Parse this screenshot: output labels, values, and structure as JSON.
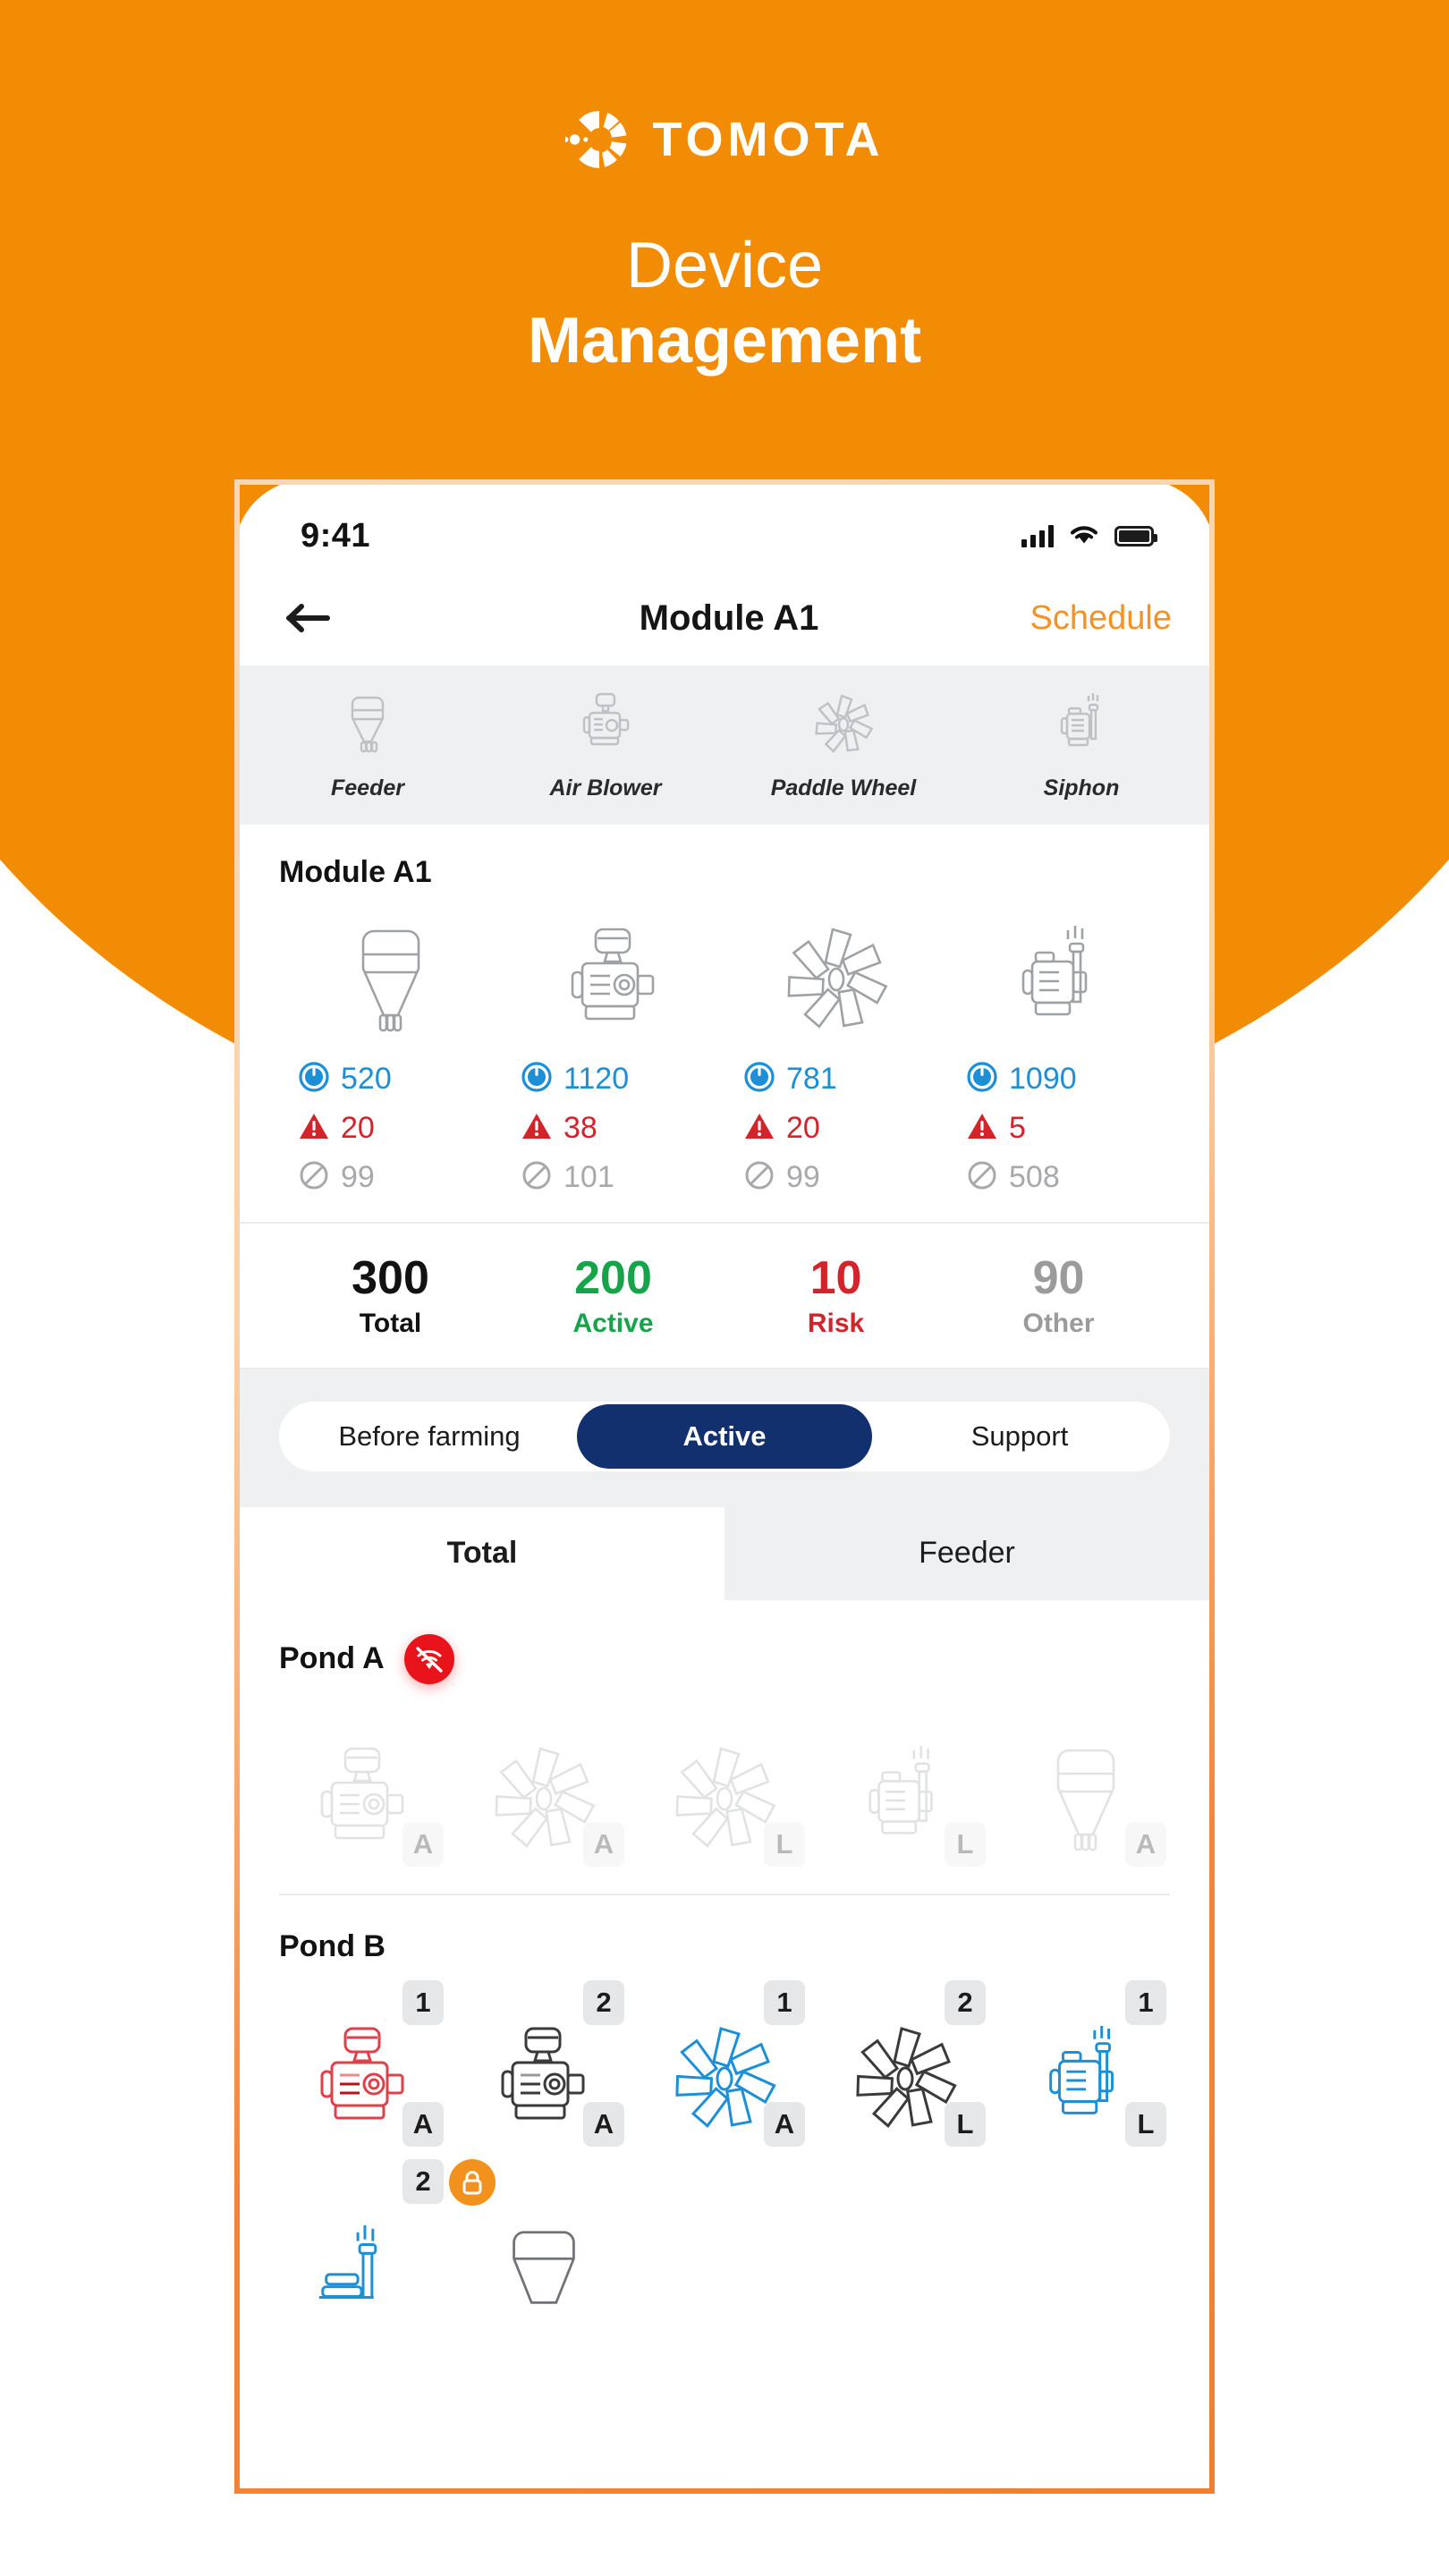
{
  "brand": {
    "name": "TOMOTA",
    "logo_icon": "tomota-circle-logo"
  },
  "hero": {
    "line1": "Device",
    "line2": "Management"
  },
  "statusbar": {
    "time": "9:41",
    "signal_icon": "cellular-signal-icon",
    "wifi_icon": "wifi-icon",
    "battery_icon": "battery-full-icon"
  },
  "navbar": {
    "back_icon": "back-arrow-icon",
    "title": "Module A1",
    "action": "Schedule",
    "action_color": "#F59226"
  },
  "categories": [
    {
      "label": "Feeder",
      "icon": "feeder-icon"
    },
    {
      "label": "Air Blower",
      "icon": "air-blower-icon"
    },
    {
      "label": "Paddle Wheel",
      "icon": "paddle-wheel-icon"
    },
    {
      "label": "Siphon",
      "icon": "siphon-icon"
    }
  ],
  "module": {
    "name": "Module A1",
    "devices": [
      {
        "icon": "feeder-icon",
        "power": "520",
        "risk": "20",
        "off": "99"
      },
      {
        "icon": "air-blower-icon",
        "power": "1120",
        "risk": "38",
        "off": "101"
      },
      {
        "icon": "paddle-wheel-icon",
        "power": "781",
        "risk": "20",
        "off": "99"
      },
      {
        "icon": "siphon-icon",
        "power": "1090",
        "risk": "5",
        "off": "508"
      }
    ],
    "stat_icons": {
      "power": "power-button-icon",
      "risk": "warning-triangle-icon",
      "off": "no-entry-icon"
    },
    "stat_colors": {
      "power": "#1C8FD6",
      "risk": "#D3232B",
      "off": "#A7A9AC"
    }
  },
  "summary": [
    {
      "value": "300",
      "label": "Total",
      "color": "#121212"
    },
    {
      "value": "200",
      "label": "Active",
      "color": "#16A34A"
    },
    {
      "value": "10",
      "label": "Risk",
      "color": "#D3232B"
    },
    {
      "value": "90",
      "label": "Other",
      "color": "#9B9B9B"
    }
  ],
  "segmented": {
    "options": [
      "Before farming",
      "Active",
      "Support"
    ],
    "selected": "Active",
    "selected_color": "#13306E"
  },
  "tabs": {
    "items": [
      "Total",
      "Feeder"
    ],
    "selected": "Total"
  },
  "ponds": [
    {
      "name": "Pond A",
      "status_badge": "wifi-off-icon",
      "status_color": "#E8131B",
      "offline": true,
      "rows": [
        [
          {
            "icon": "air-blower-icon",
            "num": "",
            "letter": "A",
            "color": "gray"
          },
          {
            "icon": "paddle-wheel-icon",
            "num": "",
            "letter": "A",
            "color": "gray"
          },
          {
            "icon": "paddle-wheel-icon",
            "num": "",
            "letter": "L",
            "color": "gray"
          },
          {
            "icon": "siphon-icon",
            "num": "",
            "letter": "L",
            "color": "gray"
          },
          {
            "icon": "feeder-icon",
            "num": "",
            "letter": "A",
            "color": "gray"
          }
        ]
      ]
    },
    {
      "name": "Pond B",
      "status_badge": "",
      "offline": false,
      "rows": [
        [
          {
            "icon": "air-blower-icon",
            "num": "1",
            "letter": "A",
            "color": "red"
          },
          {
            "icon": "air-blower-icon",
            "num": "2",
            "letter": "A",
            "color": "dark"
          },
          {
            "icon": "paddle-wheel-icon",
            "num": "1",
            "letter": "A",
            "color": "blue"
          },
          {
            "icon": "paddle-wheel-icon",
            "num": "2",
            "letter": "L",
            "color": "dark"
          },
          {
            "icon": "siphon-icon",
            "num": "1",
            "letter": "L",
            "color": "blue"
          }
        ],
        [
          {
            "icon": "siphon-pipe-icon",
            "num": "2",
            "letter": "",
            "color": "blue"
          },
          {
            "icon": "feeder-icon",
            "num": "",
            "letter": "",
            "color": "dark",
            "lock": "lock-icon"
          }
        ]
      ]
    }
  ],
  "theme": {
    "orange": "#F28C04",
    "frame_orange": "#F08030",
    "navy": "#13306E",
    "blue": "#1C8FD6",
    "red": "#D3232B",
    "green": "#16A34A"
  }
}
